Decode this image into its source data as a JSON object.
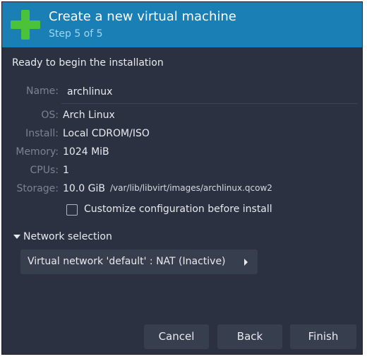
{
  "header": {
    "title": "Create a new virtual machine",
    "subtitle": "Step 5 of 5",
    "icon": "plus-icon",
    "accent": "#1a7fb5",
    "icon_color": "#4cc23a"
  },
  "summary": {
    "heading": "Ready to begin the installation",
    "name_label": "Name:",
    "name_value": "archlinux",
    "os_label": "OS:",
    "os_value": "Arch Linux",
    "install_label": "Install:",
    "install_value": "Local CDROM/ISO",
    "memory_label": "Memory:",
    "memory_value": "1024 MiB",
    "cpus_label": "CPUs:",
    "cpus_value": "1",
    "storage_label": "Storage:",
    "storage_value": "10.0 GiB",
    "storage_path": "/var/lib/libvirt/images/archlinux.qcow2"
  },
  "customize": {
    "label": "Customize configuration before install",
    "checked": false
  },
  "network": {
    "expander_label": "Network selection",
    "selected": "Virtual network 'default' : NAT (Inactive)"
  },
  "buttons": {
    "cancel": "Cancel",
    "back": "Back",
    "finish": "Finish"
  }
}
